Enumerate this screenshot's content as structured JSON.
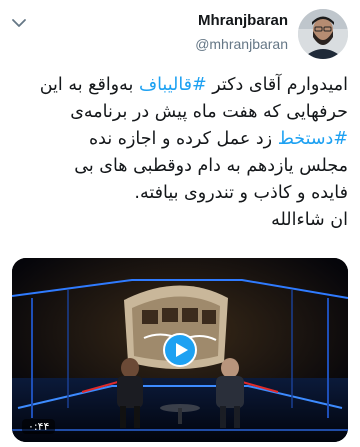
{
  "author": {
    "name": "Mhranjbaran",
    "handle": "@mhranjbaran",
    "avatar_icon": "profile-photo"
  },
  "tweet": {
    "line1_pre": "امیدوارم آقای دکتر ",
    "hashtag1": "#قالیباف",
    "line1_post": " به‌واقع به این",
    "line2": "حرفهایی که هفت  ماه پیش در برنامه‌ی",
    "hashtag2": "#دستخط",
    "line3_post": " زد عمل کرده و اجازه نده",
    "line4": "مجلس یازدهم به دام دوقطبی های بی",
    "line5": "فایده و کاذب و تندروی بیافته.",
    "line6": "ان شاءالله"
  },
  "media": {
    "duration": "۰:۴۴",
    "play_icon": "play-icon"
  },
  "colors": {
    "link": "#1da1f2",
    "handle": "#657786",
    "text": "#14171a"
  }
}
